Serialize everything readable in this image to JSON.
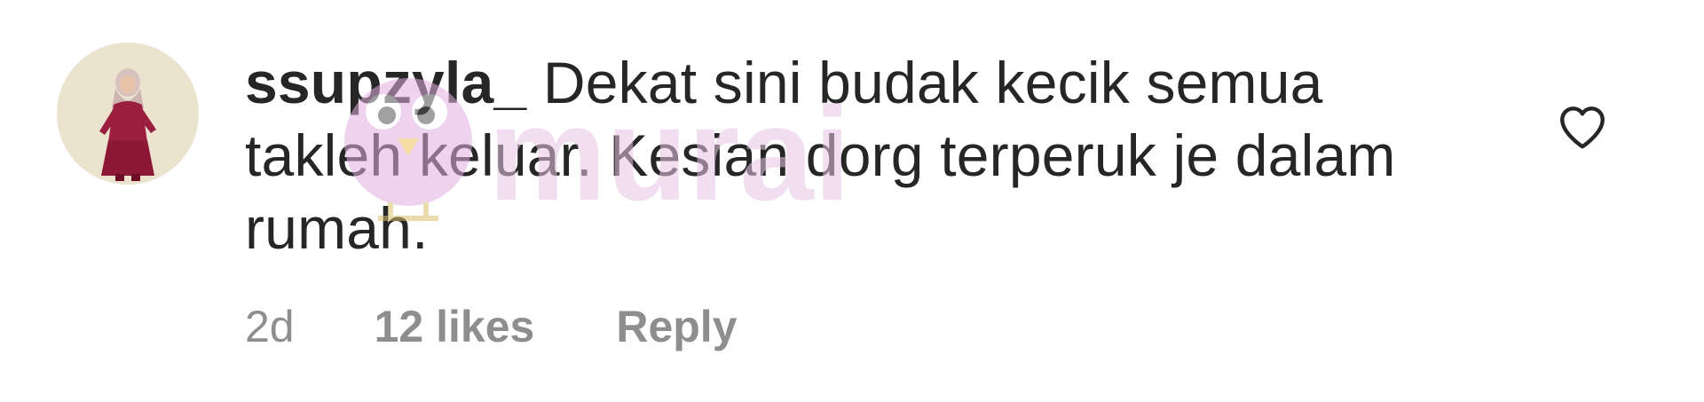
{
  "comment": {
    "username": "ssupzyla_",
    "text": "Dekat sini budak kecik semua takleh keluar. Kesian dorg terperuk je dalam rumah.",
    "time": "2d",
    "likes": "12 likes",
    "reply_label": "Reply"
  },
  "icons": {
    "like": "heart-icon",
    "avatar": "profile-avatar"
  },
  "watermark": {
    "text": "murai"
  },
  "colors": {
    "text": "#262626",
    "meta": "#8e8e8e",
    "heart_stroke": "#262626",
    "watermark": "#e7c6e6"
  }
}
